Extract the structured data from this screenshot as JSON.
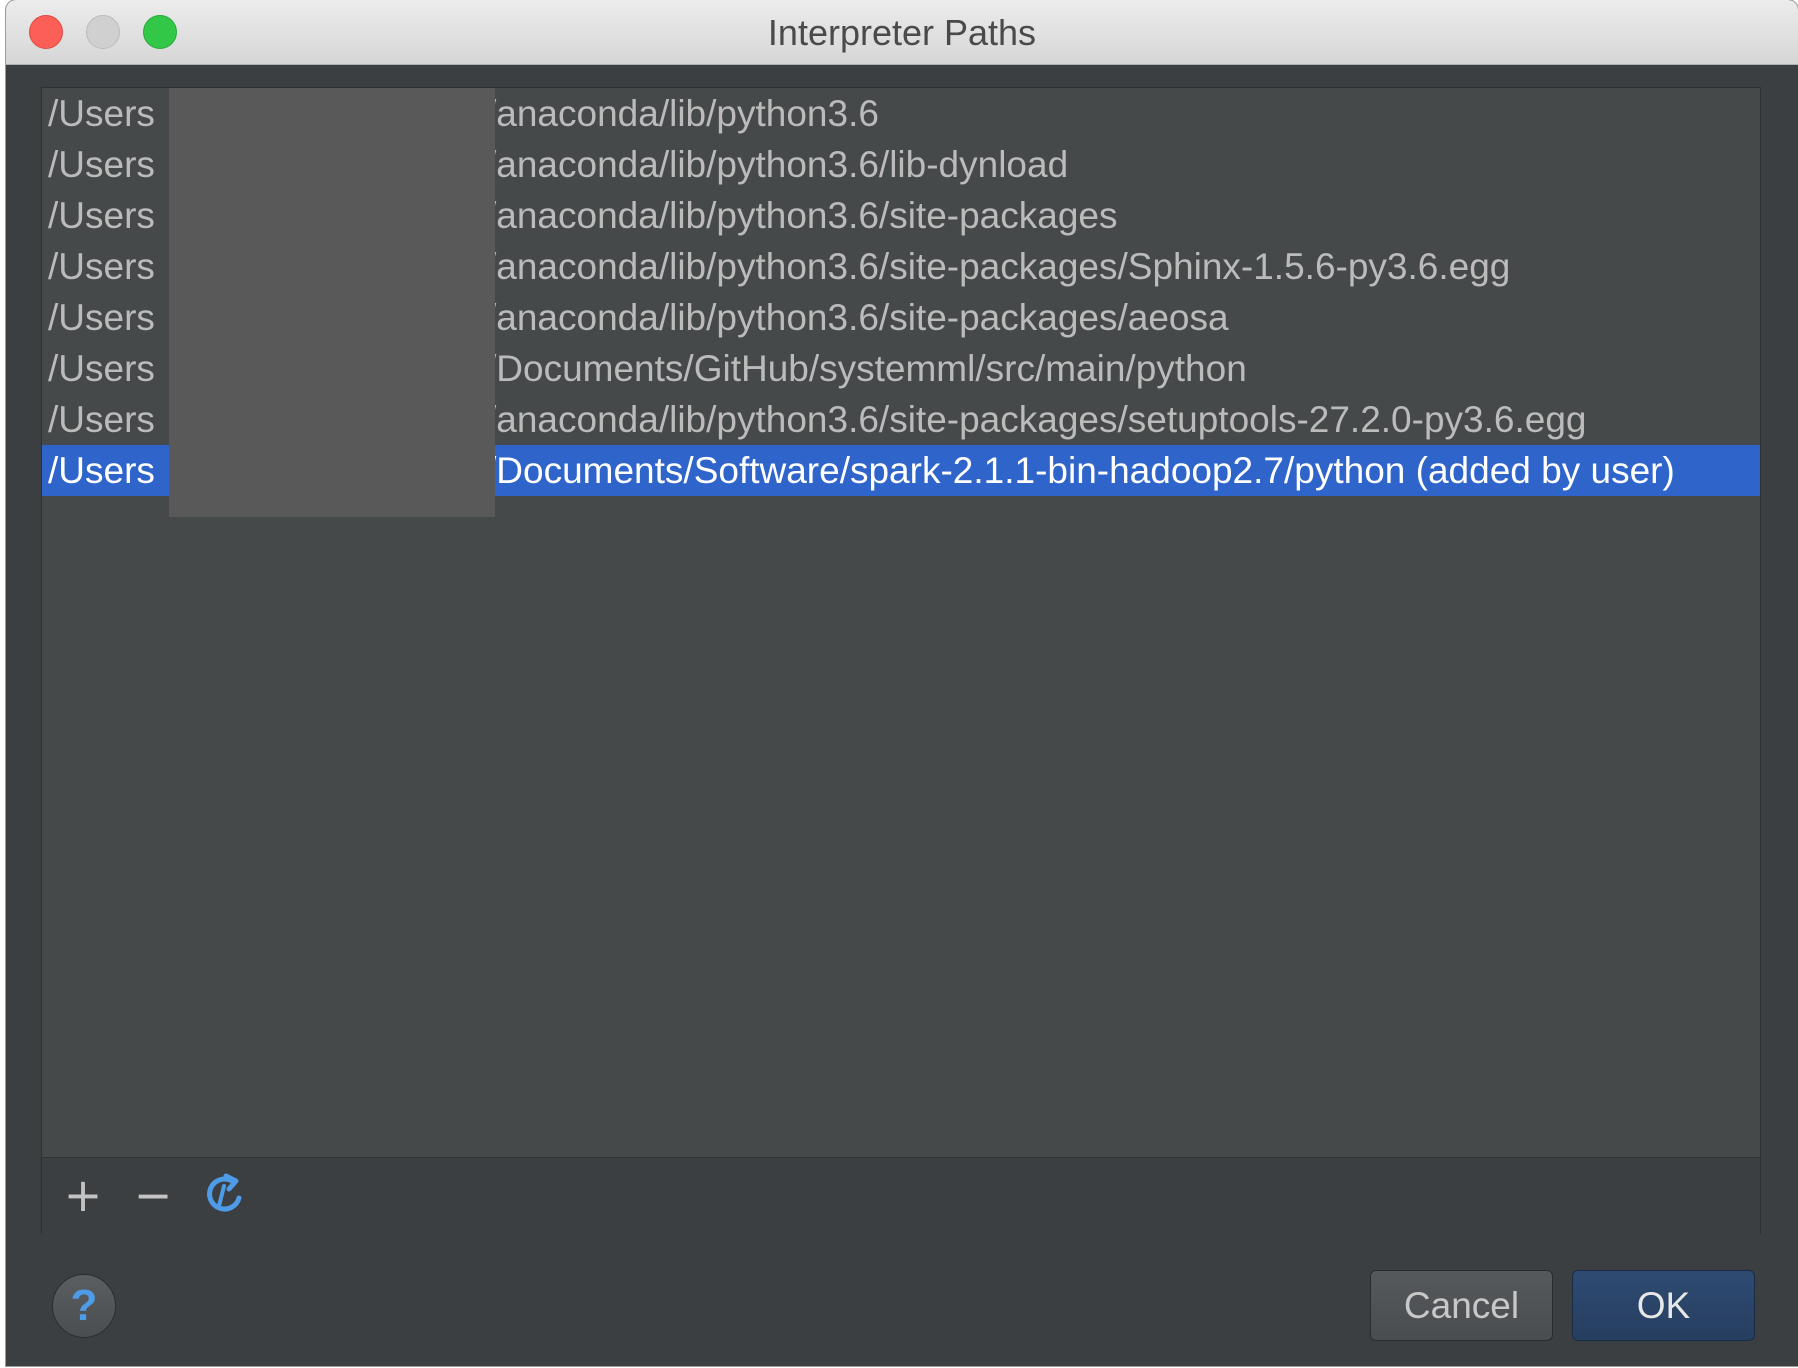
{
  "window": {
    "title": "Interpreter Paths"
  },
  "paths": [
    {
      "prefix": "/Users",
      "suffix": "/anaconda/lib/python3.6",
      "selected": false
    },
    {
      "prefix": "/Users",
      "suffix": "/anaconda/lib/python3.6/lib-dynload",
      "selected": false
    },
    {
      "prefix": "/Users",
      "suffix": "/anaconda/lib/python3.6/site-packages",
      "selected": false
    },
    {
      "prefix": "/Users",
      "suffix": "/anaconda/lib/python3.6/site-packages/Sphinx-1.5.6-py3.6.egg",
      "selected": false
    },
    {
      "prefix": "/Users",
      "suffix": "/anaconda/lib/python3.6/site-packages/aeosa",
      "selected": false
    },
    {
      "prefix": "/Users",
      "suffix": "/Documents/GitHub/systemml/src/main/python",
      "selected": false
    },
    {
      "prefix": "/Users",
      "suffix": "/anaconda/lib/python3.6/site-packages/setuptools-27.2.0-py3.6.egg",
      "selected": false
    },
    {
      "prefix": "/Users",
      "suffix": "/Documents/Software/spark-2.1.1-bin-hadoop2.7/python  (added by user)",
      "selected": true
    }
  ],
  "toolbar": {
    "add_glyph": "+",
    "remove_glyph": "−",
    "reload_icon": "reload-icon"
  },
  "footer": {
    "help_glyph": "?",
    "cancel_label": "Cancel",
    "ok_label": "OK"
  },
  "colors": {
    "selection": "#2f65ca",
    "accent": "#4e9be8"
  }
}
